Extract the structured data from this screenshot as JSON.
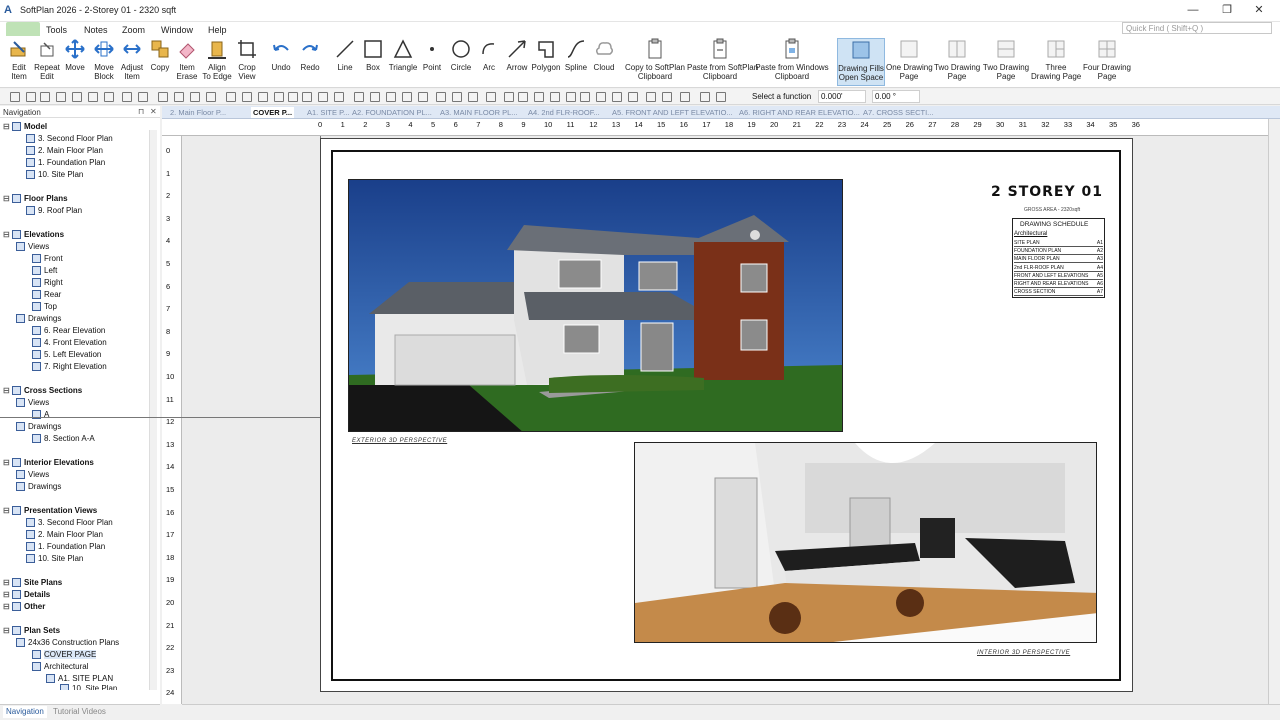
{
  "window": {
    "title": "SoftPlan 2026 - 2-Storey 01 - 2320 sqft",
    "minimize": "—",
    "maximize": "❐",
    "close": "✕"
  },
  "menu": {
    "items": [
      "Tools",
      "Notes",
      "Zoom",
      "Window",
      "Help"
    ],
    "quick_find_placeholder": "Quick Find ( Shift+Q )"
  },
  "ribbon": {
    "buttons": [
      {
        "label": "Edit\nItem"
      },
      {
        "label": "Repeat\nEdit"
      },
      {
        "label": "Move"
      },
      {
        "label": "Move\nBlock"
      },
      {
        "label": "Adjust\nItem"
      },
      {
        "label": "Copy"
      },
      {
        "label": "Item\nErase"
      },
      {
        "label": "Align\nTo Edge"
      },
      {
        "label": "Crop\nView"
      },
      {
        "label": "Undo"
      },
      {
        "label": "Redo"
      },
      {
        "label": "Line"
      },
      {
        "label": "Box"
      },
      {
        "label": "Triangle"
      },
      {
        "label": "Point"
      },
      {
        "label": "Circle"
      },
      {
        "label": "Arc"
      },
      {
        "label": "Arrow"
      },
      {
        "label": "Polygon"
      },
      {
        "label": "Spline"
      },
      {
        "label": "Cloud"
      },
      {
        "label": "Copy to SoftPlan\nClipboard"
      },
      {
        "label": "Paste from SoftPlan\nClipboard"
      },
      {
        "label": "Paste from Windows\nClipboard"
      },
      {
        "label": "Drawing Fills\nOpen Space"
      },
      {
        "label": "One Drawing\nPage"
      },
      {
        "label": "Two Drawing\nPage"
      },
      {
        "label": "Two Drawing\nPage"
      },
      {
        "label": "Three\nDrawing Page"
      },
      {
        "label": "Four Drawing\nPage"
      }
    ]
  },
  "toolbar2": {
    "select_function": "Select a function",
    "value1": "0.000'",
    "value2": "0.00 °"
  },
  "navigation": {
    "header": "Navigation",
    "tree": [
      "Model",
      "3. Second Floor Plan",
      "2. Main Floor Plan",
      "1. Foundation Plan",
      "10. Site Plan",
      "Floor Plans",
      "9. Roof Plan",
      "Elevations",
      "Views",
      "Front",
      "Left",
      "Right",
      "Rear",
      "Top",
      "Drawings",
      "6. Rear Elevation",
      "4. Front Elevation",
      "5. Left Elevation",
      "7. Right Elevation",
      "Cross Sections",
      "Views",
      "A",
      "Drawings",
      "8. Section A-A",
      "Interior Elevations",
      "Views",
      "Drawings",
      "Presentation Views",
      "3. Second Floor Plan",
      "2. Main Floor Plan",
      "1. Foundation Plan",
      "10. Site Plan",
      "Site Plans",
      "Details",
      "Other",
      "Plan Sets",
      "24x36 Construction Plans",
      "COVER PAGE",
      "Architectural",
      "A1. SITE PLAN",
      "10. Site Plan"
    ],
    "bottom_tabs": [
      "Navigation",
      "Tutorial Videos"
    ]
  },
  "doc_tabs": [
    "2. Main Floor P...",
    "COVER P...",
    "A1. SITE P...",
    "A2. FOUNDATION PL...",
    "A3. MAIN FLOOR PL...",
    "A4. 2nd FLR-ROOF...",
    "A5. FRONT AND LEFT ELEVATIO...",
    "A6. RIGHT AND REAR ELEVATIO...",
    "A7. CROSS SECTI..."
  ],
  "ruler": {
    "h": [
      "0",
      "1",
      "2",
      "3",
      "4",
      "5",
      "6",
      "7",
      "8",
      "9",
      "10",
      "11",
      "12",
      "13",
      "14",
      "15",
      "16",
      "17",
      "18",
      "19",
      "20",
      "21",
      "22",
      "23",
      "24",
      "25",
      "26",
      "27",
      "28",
      "29",
      "30",
      "31",
      "32",
      "33",
      "34",
      "35",
      "36"
    ],
    "v": [
      "0",
      "1",
      "2",
      "3",
      "4",
      "5",
      "6",
      "7",
      "8",
      "9",
      "10",
      "11",
      "12",
      "13",
      "14",
      "15",
      "16",
      "17",
      "18",
      "19",
      "20",
      "21",
      "22",
      "23",
      "24"
    ]
  },
  "sheet": {
    "title": "2 STOREY 01",
    "gross_area": "GROSS AREA - 2320sqft",
    "schedule_title": "DRAWING SCHEDULE",
    "schedule_sub": "Architectural",
    "schedule": [
      {
        "name": "SITE PLAN",
        "num": "A1"
      },
      {
        "name": "FOUNDATION PLAN",
        "num": "A2"
      },
      {
        "name": "MAIN FLOOR PLAN",
        "num": "A3"
      },
      {
        "name": "2nd FLR-ROOF PLAN",
        "num": "A4"
      },
      {
        "name": "FRONT AND LEFT ELEVATIONS",
        "num": "A5"
      },
      {
        "name": "RIGHT AND REAR ELEVATIONS",
        "num": "A6"
      },
      {
        "name": "CROSS SECTION",
        "num": "A7"
      }
    ],
    "ext_caption": "EXTERIOR 3D PERSPECTIVE",
    "int_caption": "INTERIOR 3D PERSPECTIVE"
  }
}
